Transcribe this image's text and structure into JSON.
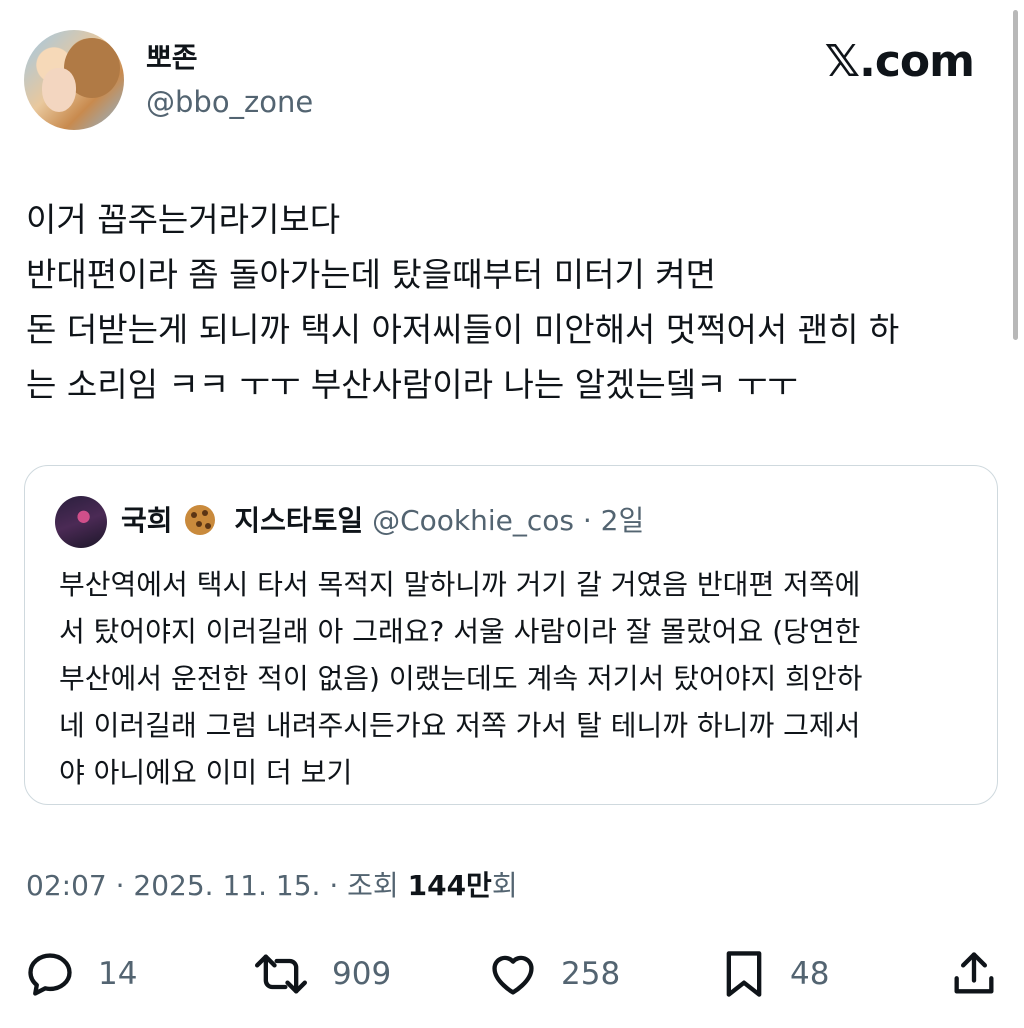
{
  "author": {
    "display_name": "뽀존",
    "handle": "@bbo_zone"
  },
  "brand": {
    "logo_text": "𝕏.com"
  },
  "tweet": {
    "text": "이거 꼽주는거라기보다\n반대편이라 좀 돌아가는데 탔을때부터 미터기 켜면\n돈 더받는게 되니까 택시 아저씨들이 미안해서 멋쩍어서 괜히 하\n는 소리임 ㅋㅋ ㅜㅜ 부산사람이라 나는 알겠는뎈ㅋ ㅜㅜ"
  },
  "quote": {
    "name_part1": "국희",
    "name_part2": "지스타토일",
    "handle": "@Cookhie_cos",
    "time": "· 2일",
    "text": "부산역에서 택시 타서 목적지 말하니까 거기 갈 거였음 반대편 저쪽에\n서 탔어야지 이러길래 아 그래요? 서울 사람이라 잘 몰랐어요 (당연한\n부산에서 운전한 적이 없음) 이랬는데도 계속 저기서 탔어야지 희안하\n네 이러길래 그럼 내려주시든가요 저쪽 가서 탈 테니까 하니까 그제서\n야 아니에요 이미 더 보기"
  },
  "meta": {
    "time": "02:07",
    "date": "2025. 11. 15.",
    "views_label": "조회",
    "views_count": "144만",
    "views_suffix": "회"
  },
  "actions": {
    "reply_count": "14",
    "retweet_count": "909",
    "like_count": "258",
    "bookmark_count": "48"
  },
  "icons": [
    "reply-icon",
    "retweet-icon",
    "like-icon",
    "bookmark-icon",
    "share-icon"
  ]
}
